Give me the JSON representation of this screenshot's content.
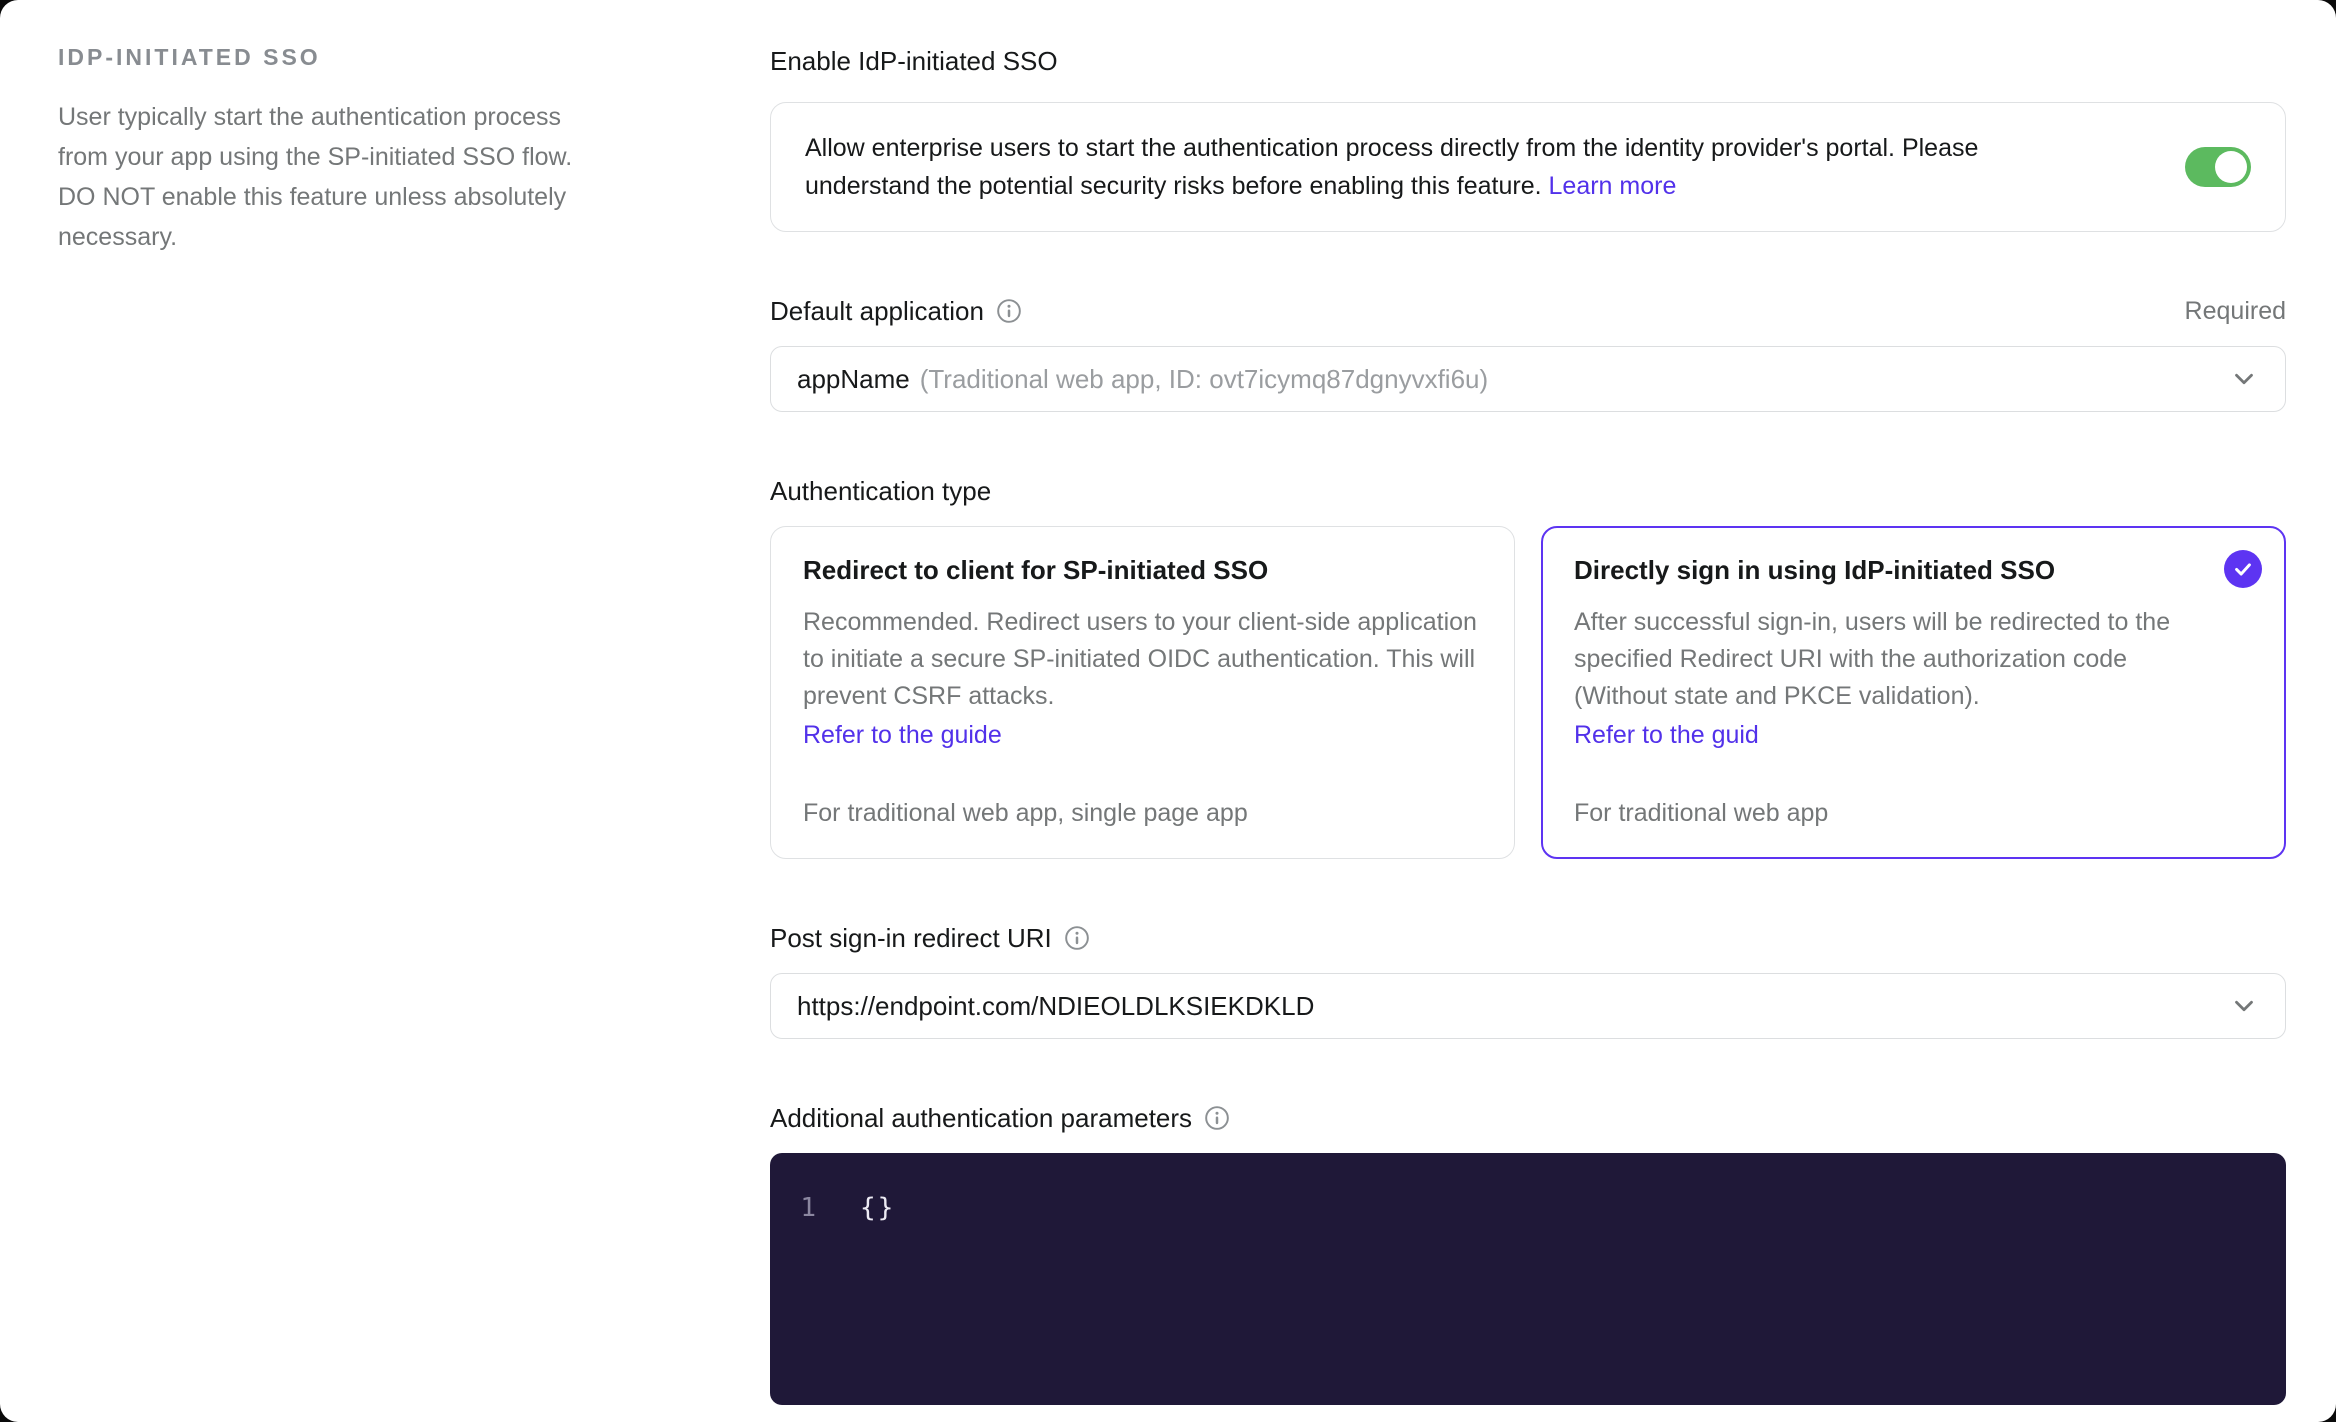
{
  "sidebar": {
    "title": "IDP-INITIATED SSO",
    "description": "User typically start the authentication process from your app using the SP-initiated SSO flow. DO NOT enable this feature unless absolutely necessary."
  },
  "enable_sso": {
    "label": "Enable IdP-initiated SSO",
    "description": "Allow enterprise users to start the authentication process directly from the identity provider's portal. Please understand the potential security risks before enabling this feature.",
    "link_label": "Learn more",
    "toggle_state": "on"
  },
  "default_application": {
    "label": "Default application",
    "required_label": "Required",
    "value": "appName",
    "value_detail": "(Traditional web app, ID: ovt7icymq87dgnyvxfi6u)"
  },
  "authentication_type": {
    "label": "Authentication type",
    "options": [
      {
        "title": "Redirect to client for SP-initiated SSO",
        "description": "Recommended. Redirect users to your client-side application to initiate a secure SP-initiated OIDC authentication. This will prevent CSRF attacks.",
        "link_label": "Refer to the guide",
        "footer": "For traditional web app, single page app",
        "selected": false
      },
      {
        "title": "Directly sign in using IdP-initiated SSO",
        "description": "After successful sign-in, users will be redirected to the specified Redirect URI with the authorization code (Without state and PKCE validation).",
        "link_label": "Refer to the guid",
        "footer": "For traditional web app",
        "selected": true
      }
    ]
  },
  "redirect_uri": {
    "label": "Post sign-in redirect URI",
    "value": "https://endpoint.com/NDIEOLDLKSIEKDKLD"
  },
  "auth_parameters": {
    "label": "Additional authentication parameters",
    "line_number": "1",
    "code": "{}"
  },
  "colors": {
    "accent_purple": "#5d34f2",
    "link_purple": "#5231ea",
    "toggle_green": "#5cba5f",
    "editor_background": "#1f1838",
    "text_primary": "#17191a",
    "text_secondary": "#747778"
  }
}
